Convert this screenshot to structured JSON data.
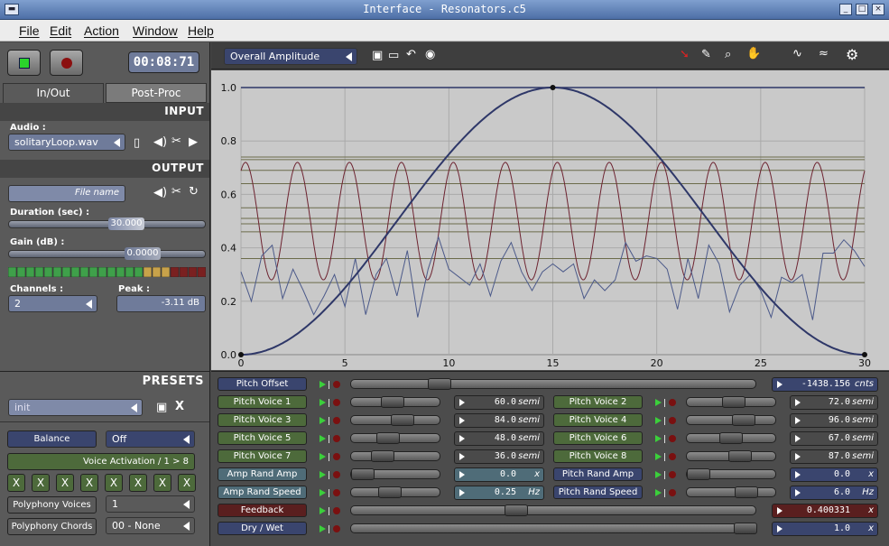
{
  "window": {
    "title": "Interface - Resonators.c5"
  },
  "menu": [
    "File",
    "Edit",
    "Action",
    "Window",
    "Help"
  ],
  "transport": {
    "time": "00:08:71"
  },
  "tabs": [
    "In/Out",
    "Post-Proc"
  ],
  "input": {
    "header": "INPUT",
    "audio_label": "Audio :",
    "audio_file": "solitaryLoop.wav"
  },
  "output": {
    "header": "OUTPUT",
    "file_placeholder": "File name",
    "duration_label": "Duration (sec) :",
    "duration_value": "30.000",
    "gain_label": "Gain (dB) :",
    "gain_value": "0.0000",
    "channels_label": "Channels :",
    "channels_value": "2",
    "peak_label": "Peak :",
    "peak_value": "-3.11 dB"
  },
  "presets": {
    "header": "PRESETS",
    "current": "init",
    "balance_label": "Balance",
    "balance_value": "Off",
    "voice_activation": "Voice Activation / 1 > 8",
    "x_label": "X",
    "polyphony_voices_label": "Polyphony Voices",
    "polyphony_voices_value": "1",
    "polyphony_chords_label": "Polyphony Chords",
    "polyphony_chords_value": "00 - None"
  },
  "graph": {
    "selector": "Overall Amplitude",
    "x_ticks": [
      "0",
      "5",
      "10",
      "15",
      "20",
      "25",
      "30"
    ],
    "y_ticks": [
      "0.0",
      "0.2",
      "0.4",
      "0.6",
      "0.8",
      "1.0"
    ]
  },
  "colors": {
    "panel": "#5a5a5a",
    "graph_bg": "#c9c9c9",
    "envelope": "#2e3768",
    "sine": "#6d2330",
    "noise": "#4c5a8a",
    "hline": "#6b6b4a"
  },
  "chart_data": {
    "type": "line",
    "xlim": [
      0,
      30
    ],
    "ylim": [
      0,
      1
    ],
    "series": [
      {
        "x": [
          0,
          15,
          30
        ],
        "y": [
          0,
          1,
          0
        ],
        "shape": "half-cosine"
      },
      {
        "shape": "sine",
        "center": 0.5,
        "amplitude": 0.22,
        "cycles": 12
      },
      {
        "x": [
          0,
          0.5,
          1,
          1.5,
          2,
          2.5,
          3,
          3.5,
          4,
          4.5,
          5,
          5.5,
          6,
          6.5,
          7,
          7.5,
          8,
          8.5,
          9,
          9.5,
          10,
          10.5,
          11,
          11.5,
          12,
          12.5,
          13,
          13.5,
          14,
          14.5,
          15,
          15.5,
          16,
          16.5,
          17,
          17.5,
          18,
          18.5,
          19,
          19.5,
          20,
          20.5,
          21,
          21.5,
          22,
          22.5,
          23,
          23.5,
          24,
          24.5,
          25,
          25.5,
          26,
          26.5,
          27,
          27.5,
          28,
          28.5,
          29,
          29.5,
          30
        ],
        "y": [
          0.31,
          0.2,
          0.37,
          0.41,
          0.21,
          0.32,
          0.24,
          0.15,
          0.22,
          0.3,
          0.18,
          0.36,
          0.15,
          0.3,
          0.36,
          0.22,
          0.39,
          0.14,
          0.32,
          0.44,
          0.32,
          0.29,
          0.26,
          0.34,
          0.22,
          0.35,
          0.42,
          0.31,
          0.24,
          0.31,
          0.34,
          0.31,
          0.34,
          0.21,
          0.28,
          0.24,
          0.28,
          0.42,
          0.35,
          0.37,
          0.36,
          0.32,
          0.17,
          0.36,
          0.21,
          0.41,
          0.34,
          0.16,
          0.26,
          0.3,
          0.24,
          0.14,
          0.29,
          0.27,
          0.3,
          0.13,
          0.38,
          0.38,
          0.43,
          0.39,
          0.33
        ]
      }
    ],
    "hlines": [
      0.74,
      0.73,
      0.69,
      0.64,
      0.55,
      0.51,
      0.49,
      0.46,
      0.36,
      0.27
    ]
  },
  "sliders": [
    {
      "name": "Pitch Offset",
      "value": "-1438.156",
      "unit": "cnts",
      "pos": 0.2
    },
    {
      "name": "Pitch Voice 1",
      "value": "60.0",
      "unit": "semi",
      "pos": 0.45
    },
    {
      "name": "Pitch Voice 2",
      "value": "72.0",
      "unit": "semi",
      "pos": 0.53
    },
    {
      "name": "Pitch Voice 3",
      "value": "84.0",
      "unit": "semi",
      "pos": 0.6
    },
    {
      "name": "Pitch Voice 4",
      "value": "96.0",
      "unit": "semi",
      "pos": 0.68
    },
    {
      "name": "Pitch Voice 5",
      "value": "48.0",
      "unit": "semi",
      "pos": 0.38
    },
    {
      "name": "Pitch Voice 6",
      "value": "67.0",
      "unit": "semi",
      "pos": 0.49
    },
    {
      "name": "Pitch Voice 7",
      "value": "36.0",
      "unit": "semi",
      "pos": 0.3
    },
    {
      "name": "Pitch Voice 8",
      "value": "87.0",
      "unit": "semi",
      "pos": 0.62
    },
    {
      "name": "Amp Rand Amp",
      "value": "0.0",
      "unit": "x",
      "pos": 0.0
    },
    {
      "name": "Pitch Rand Amp",
      "value": "0.0",
      "unit": "x",
      "pos": 0.0
    },
    {
      "name": "Amp Rand Speed",
      "value": "0.25",
      "unit": "Hz",
      "pos": 0.4
    },
    {
      "name": "Pitch Rand Speed",
      "value": "6.0",
      "unit": "Hz",
      "pos": 0.72
    },
    {
      "name": "Feedback",
      "value": "0.400331",
      "unit": "x",
      "pos": 0.4
    },
    {
      "name": "Dry / Wet",
      "value": "1.0",
      "unit": "x",
      "pos": 1.0
    }
  ]
}
